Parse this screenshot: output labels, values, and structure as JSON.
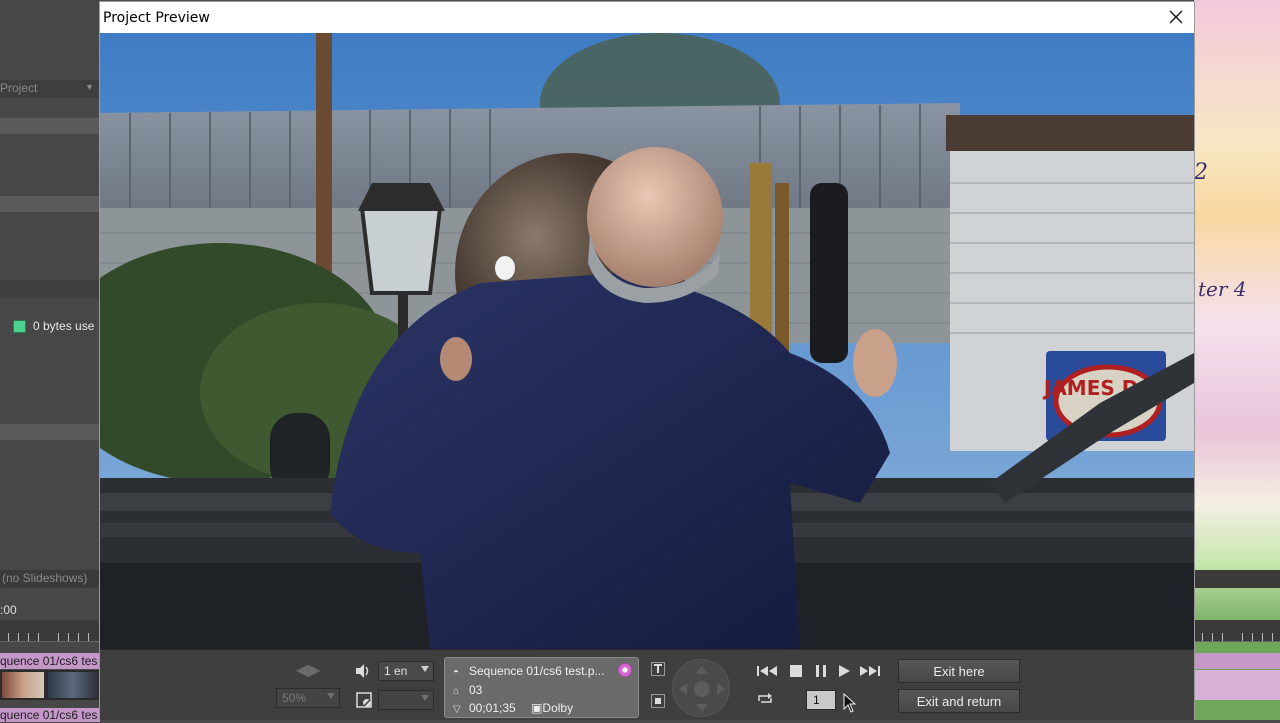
{
  "background_app": {
    "panel_label": "Project",
    "status_text": "0 bytes use",
    "slideshows_label": "(no Slideshows)",
    "timecode": ":00",
    "sequence_clip_1": "quence 01/cs6 tes",
    "sequence_clip_2": "quence 01/cs6 tes",
    "right_text_1": "2",
    "right_text_2": "ter 4"
  },
  "dialog": {
    "title": "Project Preview",
    "close_icon": "close-icon"
  },
  "controls": {
    "zoom_value": "50%",
    "audio_value": "1 en",
    "info": {
      "name": "Sequence 01/cs6 test.p...",
      "chapter": "03",
      "timecode": "00;01;35",
      "audio_format": "Dolby"
    },
    "page_value": "1",
    "exit_here_label": "Exit here",
    "exit_return_label": "Exit and return",
    "icons": [
      "audio-icon",
      "subtitle-icon",
      "angle-icon",
      "title-menu-icon",
      "menu-icon",
      "nav-pad-icon",
      "skip-back-icon",
      "stop-icon",
      "pause-icon",
      "play-icon",
      "skip-forward-icon",
      "loop-icon"
    ]
  },
  "video_sign": "JAMES DON"
}
